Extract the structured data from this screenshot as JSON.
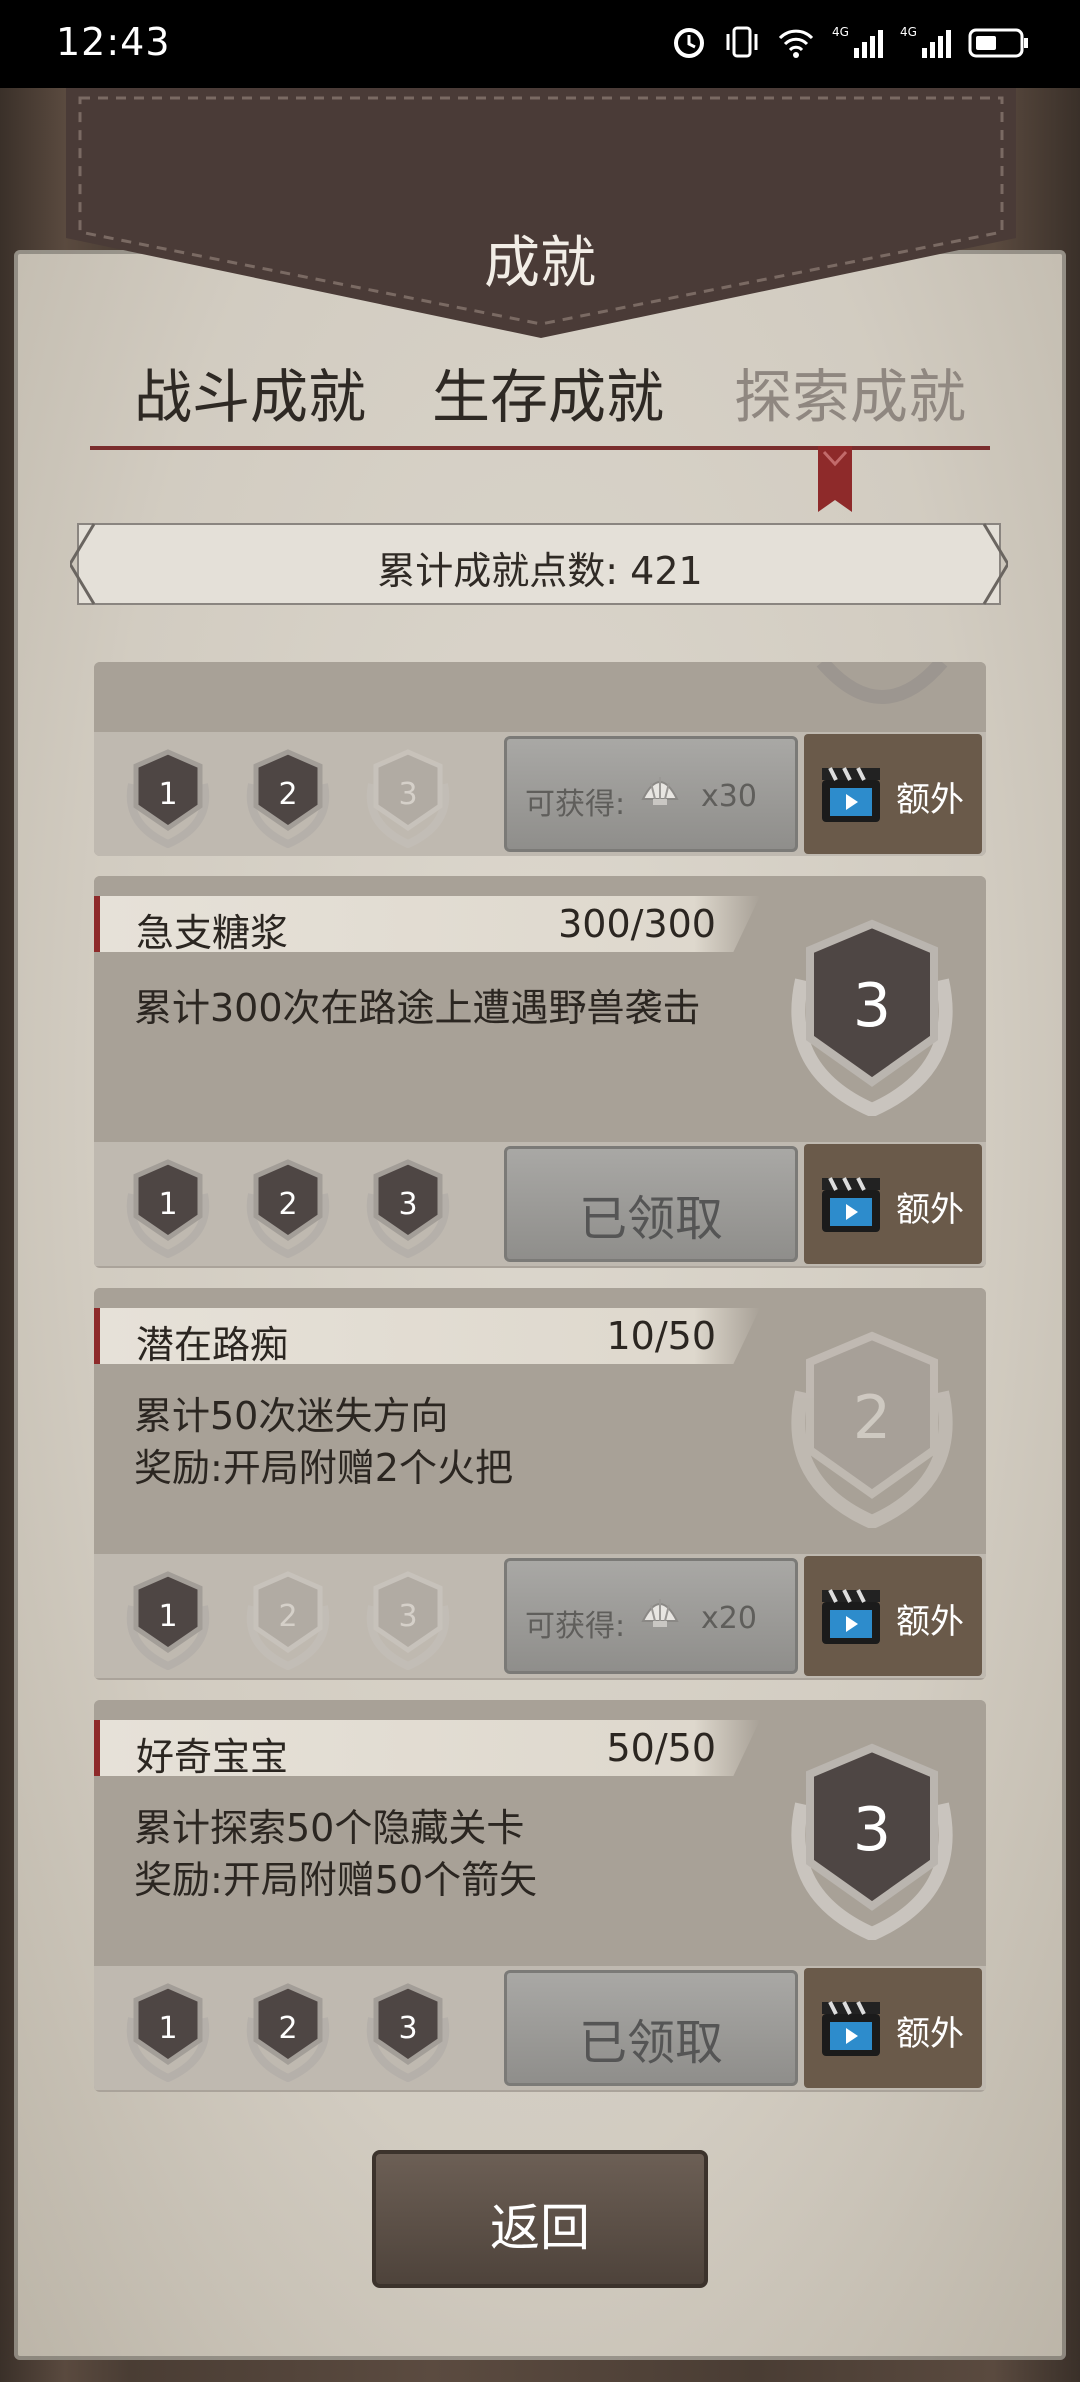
{
  "status_bar": {
    "time": "12:43"
  },
  "header": {
    "title": "成就"
  },
  "tabs": [
    {
      "label": "战斗成就",
      "active": false
    },
    {
      "label": "生存成就",
      "active": false
    },
    {
      "label": "探索成就",
      "active": true
    }
  ],
  "points": {
    "text": "累计成就点数: 421"
  },
  "cards": [
    {
      "partial": true,
      "medal_levels_achieved": 2,
      "claim": {
        "available_label": "可获得:",
        "qty": "x30"
      },
      "extra_label": "额外"
    },
    {
      "name": "急支糖浆",
      "progress": "300/300",
      "desc": [
        "累计300次在路途上遭遇野兽袭击"
      ],
      "big_medal": "3",
      "medal_levels_achieved": 3,
      "claim": {
        "done_label": "已领取"
      },
      "extra_label": "额外"
    },
    {
      "name": "潜在路痴",
      "progress": "10/50",
      "desc": [
        "累计50次迷失方向",
        "奖励:开局附赠2个火把"
      ],
      "big_medal": "2",
      "medal_levels_achieved": 1,
      "claim": {
        "available_label": "可获得:",
        "qty": "x20"
      },
      "extra_label": "额外"
    },
    {
      "name": "好奇宝宝",
      "progress": "50/50",
      "desc": [
        "累计探索50个隐藏关卡",
        "奖励:开局附赠50个箭矢"
      ],
      "big_medal": "3",
      "medal_levels_achieved": 3,
      "claim": {
        "done_label": "已领取"
      },
      "extra_label": "额外"
    }
  ],
  "small_medal_numbers": [
    "1",
    "2",
    "3"
  ],
  "back_button": {
    "label": "返回"
  },
  "colors": {
    "accent_red": "#8e2a2a",
    "card_bg": "#aaa39a",
    "paper": "#d6d0c5"
  }
}
